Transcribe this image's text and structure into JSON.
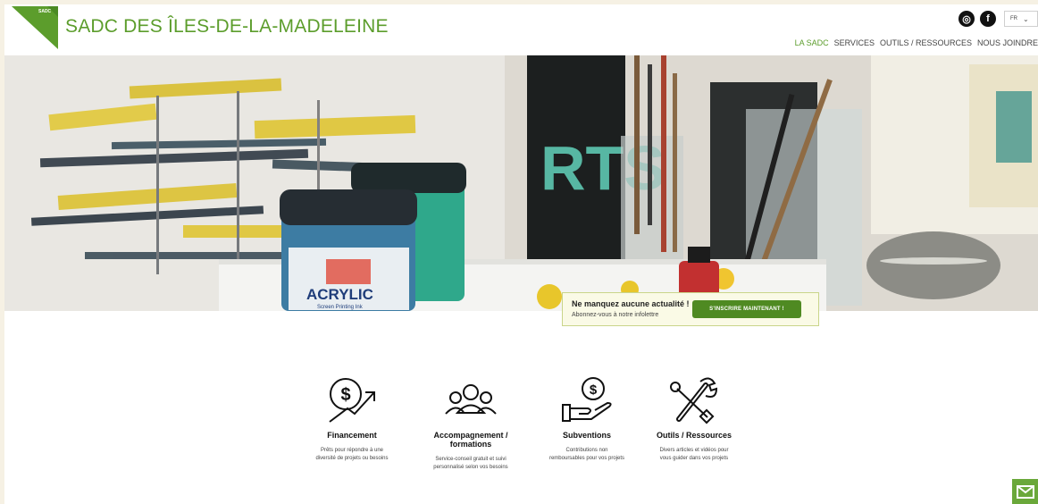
{
  "header": {
    "logo_text": "SADC",
    "site_title": "SADC DES ÎLES-DE-LA-MADELEINE",
    "social": [
      {
        "name": "instagram-icon",
        "glyph": "◎"
      },
      {
        "name": "facebook-icon",
        "glyph": "f"
      }
    ],
    "language": {
      "selected": "FR"
    },
    "nav": [
      {
        "label": "LA SADC",
        "active": true
      },
      {
        "label": "SERVICES",
        "active": false
      },
      {
        "label": "OUTILS / RESSOURCES",
        "active": false
      },
      {
        "label": "NOUS JOINDRE",
        "active": false
      }
    ]
  },
  "hero": {
    "jar_label": "ACRYLIC",
    "jar_sublabel": "Screen Printing Ink",
    "poster_text": "RTS"
  },
  "newsletter": {
    "title": "Ne manquez aucune actualité !",
    "subtitle": "Abonnez-vous à notre infolettre",
    "button": "S'INSCRIRE MAINTENANT !"
  },
  "services": [
    {
      "title": "Financement",
      "desc_line1": "Prêts pour répondre à une",
      "desc_line2": "diversité de projets ou besoins",
      "icon": "financing-icon"
    },
    {
      "title": "Accompagnement / formations",
      "desc_line1": "Service-conseil gratuit et suivi",
      "desc_line2": "personnalisé selon vos besoins",
      "icon": "coaching-icon"
    },
    {
      "title": "Subventions",
      "desc_line1": "Contributions non",
      "desc_line2": "remboursables pour vos projets",
      "icon": "subsidy-icon"
    },
    {
      "title": "Outils / Ressources",
      "desc_line1": "Divers articles et vidéos pour",
      "desc_line2": "vous guider dans vos projets",
      "icon": "tools-icon"
    }
  ],
  "colors": {
    "brand_green": "#5c9d2c",
    "button_green": "#4f8a22",
    "page_border": "#f6f1e4"
  }
}
